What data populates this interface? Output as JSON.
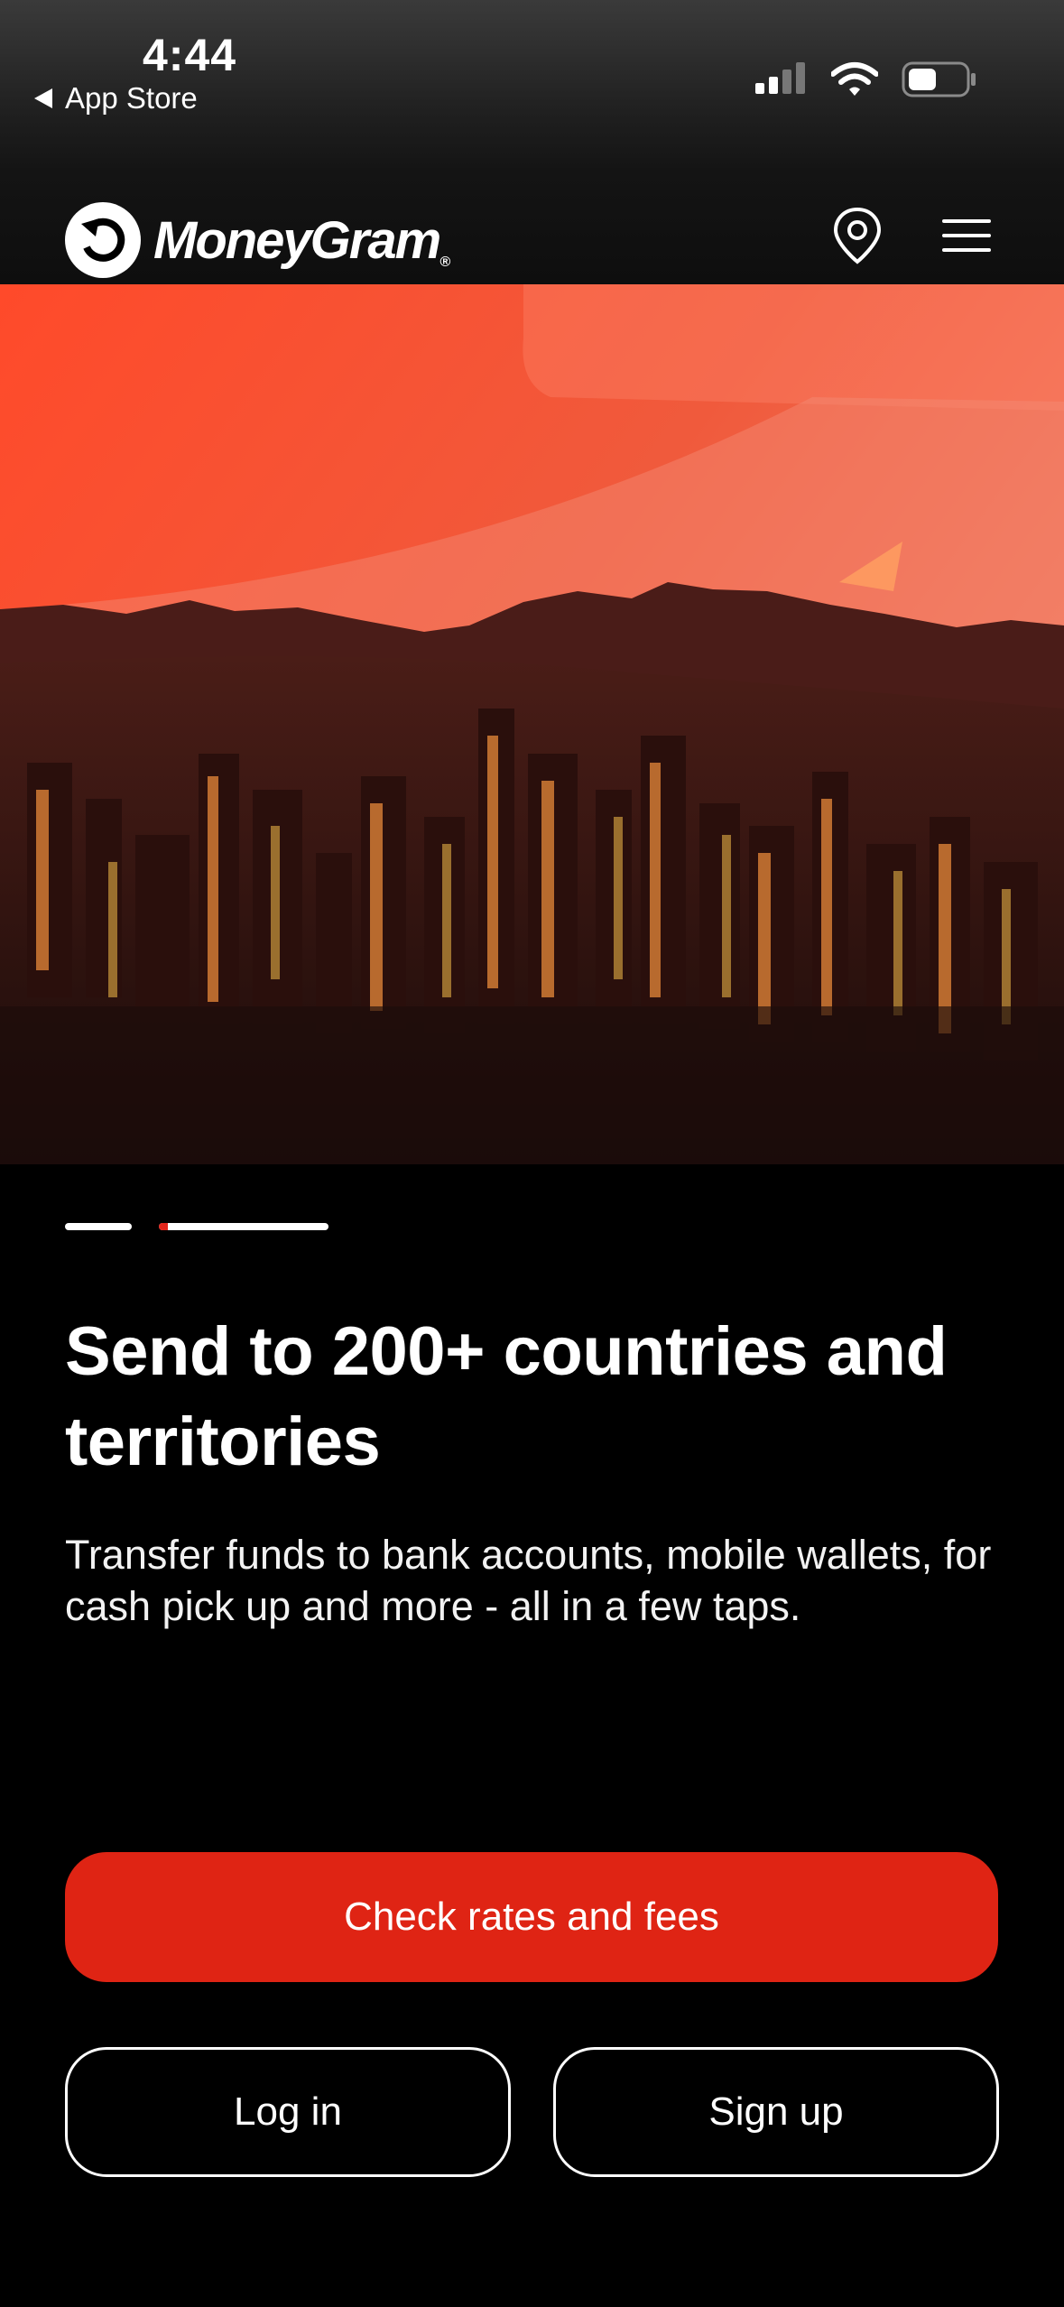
{
  "status_bar": {
    "time": "4:44",
    "back_app": "App Store",
    "icons": [
      "cellular-signal-icon",
      "wifi-icon",
      "battery-icon"
    ]
  },
  "header": {
    "brand_name": "MoneyGram",
    "brand_registered": "®",
    "icons": [
      "moneygram-logo-icon",
      "location-pin-icon",
      "hamburger-menu-icon"
    ]
  },
  "hero": {
    "image": "aerial-city-skyline-sunset",
    "accent_color": "#e1261c"
  },
  "carousel": {
    "slides": 2,
    "active_index": 1
  },
  "content": {
    "headline": "Send to 200+ countries and territories",
    "subtext": "Transfer funds to bank accounts, mobile wallets, for cash pick up and more - all in a few taps."
  },
  "actions": {
    "primary_label": "Check rates and fees",
    "login_label": "Log in",
    "signup_label": "Sign up"
  },
  "colors": {
    "background": "#000000",
    "primary_button": "#df2414"
  }
}
